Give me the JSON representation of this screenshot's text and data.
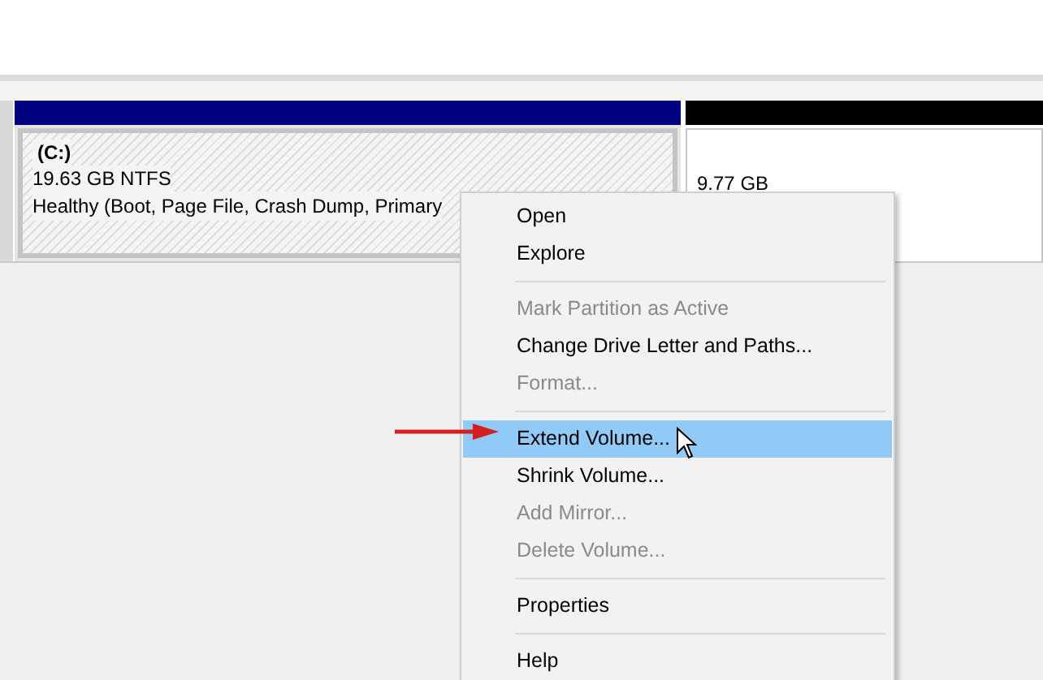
{
  "volume": {
    "label": "(C:)",
    "size": "19.63 GB NTFS",
    "status": "Healthy (Boot, Page File, Crash Dump, Primary"
  },
  "unallocated": {
    "size": "9.77 GB"
  },
  "context_menu": {
    "items": [
      {
        "kind": "item",
        "label": "Open",
        "disabled": false,
        "selected": false
      },
      {
        "kind": "item",
        "label": "Explore",
        "disabled": false,
        "selected": false
      },
      {
        "kind": "separator"
      },
      {
        "kind": "item",
        "label": "Mark Partition as Active",
        "disabled": true,
        "selected": false
      },
      {
        "kind": "item",
        "label": "Change Drive Letter and Paths...",
        "disabled": false,
        "selected": false
      },
      {
        "kind": "item",
        "label": "Format...",
        "disabled": true,
        "selected": false
      },
      {
        "kind": "separator"
      },
      {
        "kind": "item",
        "label": "Extend Volume...",
        "disabled": false,
        "selected": true
      },
      {
        "kind": "item",
        "label": "Shrink Volume...",
        "disabled": false,
        "selected": false
      },
      {
        "kind": "item",
        "label": "Add Mirror...",
        "disabled": true,
        "selected": false
      },
      {
        "kind": "item",
        "label": "Delete Volume...",
        "disabled": true,
        "selected": false
      },
      {
        "kind": "separator"
      },
      {
        "kind": "item",
        "label": "Properties",
        "disabled": false,
        "selected": false
      },
      {
        "kind": "separator"
      },
      {
        "kind": "item",
        "label": "Help",
        "disabled": false,
        "selected": false
      }
    ]
  }
}
